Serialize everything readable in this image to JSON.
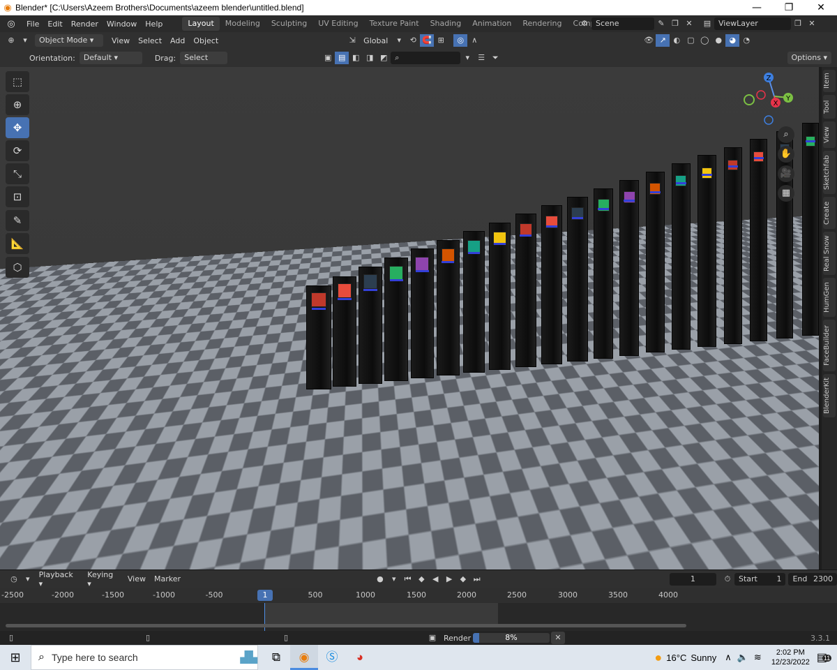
{
  "window": {
    "title": "Blender* [C:\\Users\\Azeem Brothers\\Documents\\azeem blender\\untitled.blend]",
    "minimize": "—",
    "maximize": "❐",
    "close": "✕"
  },
  "menu": {
    "items": [
      "File",
      "Edit",
      "Render",
      "Window",
      "Help"
    ],
    "workspaces": [
      "Layout",
      "Modeling",
      "Sculpting",
      "UV Editing",
      "Texture Paint",
      "Shading",
      "Animation",
      "Rendering",
      "Compositing"
    ],
    "active_workspace": "Layout",
    "scene": "Scene",
    "view_layer": "ViewLayer"
  },
  "viewport_header": {
    "mode": "Object Mode",
    "menus": [
      "View",
      "Select",
      "Add",
      "Object"
    ],
    "transform_orientation": "Global",
    "options": "Options"
  },
  "tool_settings": {
    "orientation_label": "Orientation:",
    "orientation_value": "Default",
    "drag_label": "Drag:",
    "drag_value": "Select Box"
  },
  "gizmo": {
    "x": "X",
    "y": "Y",
    "z": "Z"
  },
  "sidebar_tabs": [
    "Item",
    "Tool",
    "View",
    "Sketchfab",
    "Create",
    "Real Snow",
    "HumGen",
    "FaceBuilder",
    "BlenderKit"
  ],
  "timeline": {
    "menus": [
      "Playback",
      "Keying",
      "View",
      "Marker"
    ],
    "current_frame": "1",
    "start_label": "Start",
    "start_value": "1",
    "end_label": "End",
    "end_value": "2300",
    "ticks": [
      "-2500",
      "-2000",
      "-1500",
      "-1000",
      "-500",
      "500",
      "1000",
      "1500",
      "2000",
      "2500",
      "3000",
      "3500",
      "4000"
    ]
  },
  "status": {
    "render_label": "Render",
    "render_progress": "8%",
    "render_progress_value": 0.08,
    "version": "3.3.1"
  },
  "taskbar": {
    "search_placeholder": "Type here to search",
    "weather_temp": "16°C",
    "weather_desc": "Sunny",
    "time": "2:02 PM",
    "date": "12/23/2022",
    "notification_count": "11"
  }
}
